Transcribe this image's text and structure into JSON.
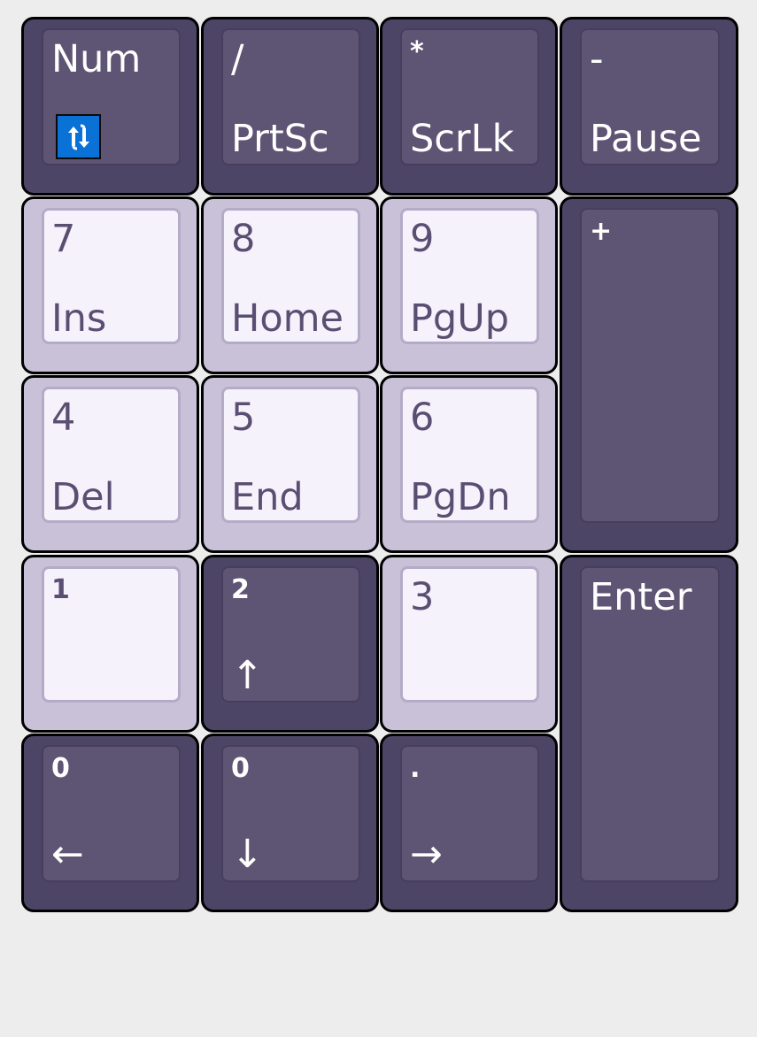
{
  "keys": {
    "num": {
      "top": "Num"
    },
    "slash": {
      "top": "/",
      "bottom": "PrtSc"
    },
    "asterisk": {
      "top": "*",
      "bottom": "ScrLk"
    },
    "minus": {
      "top": "-",
      "bottom": "Pause"
    },
    "k7": {
      "top": "7",
      "bottom": "Ins"
    },
    "k8": {
      "top": "8",
      "bottom": "Home"
    },
    "k9": {
      "top": "9",
      "bottom": "PgUp"
    },
    "plus": {
      "top": "+"
    },
    "k4": {
      "top": "4",
      "bottom": "Del"
    },
    "k5": {
      "top": "5",
      "bottom": "End"
    },
    "k6": {
      "top": "6",
      "bottom": "PgDn"
    },
    "k1": {
      "top": "1"
    },
    "k2": {
      "top": "2",
      "bottom": "↑"
    },
    "k3": {
      "top": "3"
    },
    "enter": {
      "top": "Enter"
    },
    "k0a": {
      "top": "0",
      "bottom": "←"
    },
    "k0b": {
      "top": "0",
      "bottom": "↓"
    },
    "dot": {
      "top": ".",
      "bottom": "→"
    }
  },
  "icons": {
    "numlock": "refresh-arrows-icon"
  },
  "colors": {
    "dark_key": "#4d4566",
    "dark_cap": "#5e5474",
    "light_key": "#c8c1d8",
    "light_cap": "#f6f2fc",
    "light_text": "#5a4f72",
    "badge": "#0a72d6",
    "background": "#ededed"
  }
}
